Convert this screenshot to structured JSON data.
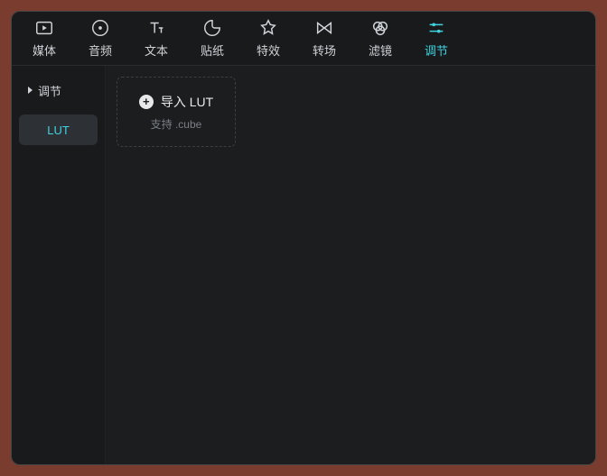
{
  "tabs": [
    {
      "id": "media",
      "label": "媒体",
      "icon": "media-icon"
    },
    {
      "id": "audio",
      "label": "音频",
      "icon": "audio-icon"
    },
    {
      "id": "text",
      "label": "文本",
      "icon": "text-icon"
    },
    {
      "id": "sticker",
      "label": "贴纸",
      "icon": "sticker-icon"
    },
    {
      "id": "effect",
      "label": "特效",
      "icon": "effect-icon"
    },
    {
      "id": "transition",
      "label": "转场",
      "icon": "transition-icon"
    },
    {
      "id": "filter",
      "label": "滤镜",
      "icon": "filter-icon"
    },
    {
      "id": "adjust",
      "label": "调节",
      "icon": "adjust-icon"
    }
  ],
  "active_tab": "adjust",
  "sidebar": {
    "items": [
      {
        "id": "adjust",
        "label": "调节",
        "expandable": true,
        "selected": false
      },
      {
        "id": "lut",
        "label": "LUT",
        "expandable": false,
        "selected": true
      }
    ]
  },
  "import_card": {
    "title": "导入 LUT",
    "subtitle": "支持 .cube"
  },
  "colors": {
    "accent": "#3fd2e0",
    "bg": "#181a1c",
    "panel": "#1b1d1f",
    "border": "#2a2c2f"
  }
}
